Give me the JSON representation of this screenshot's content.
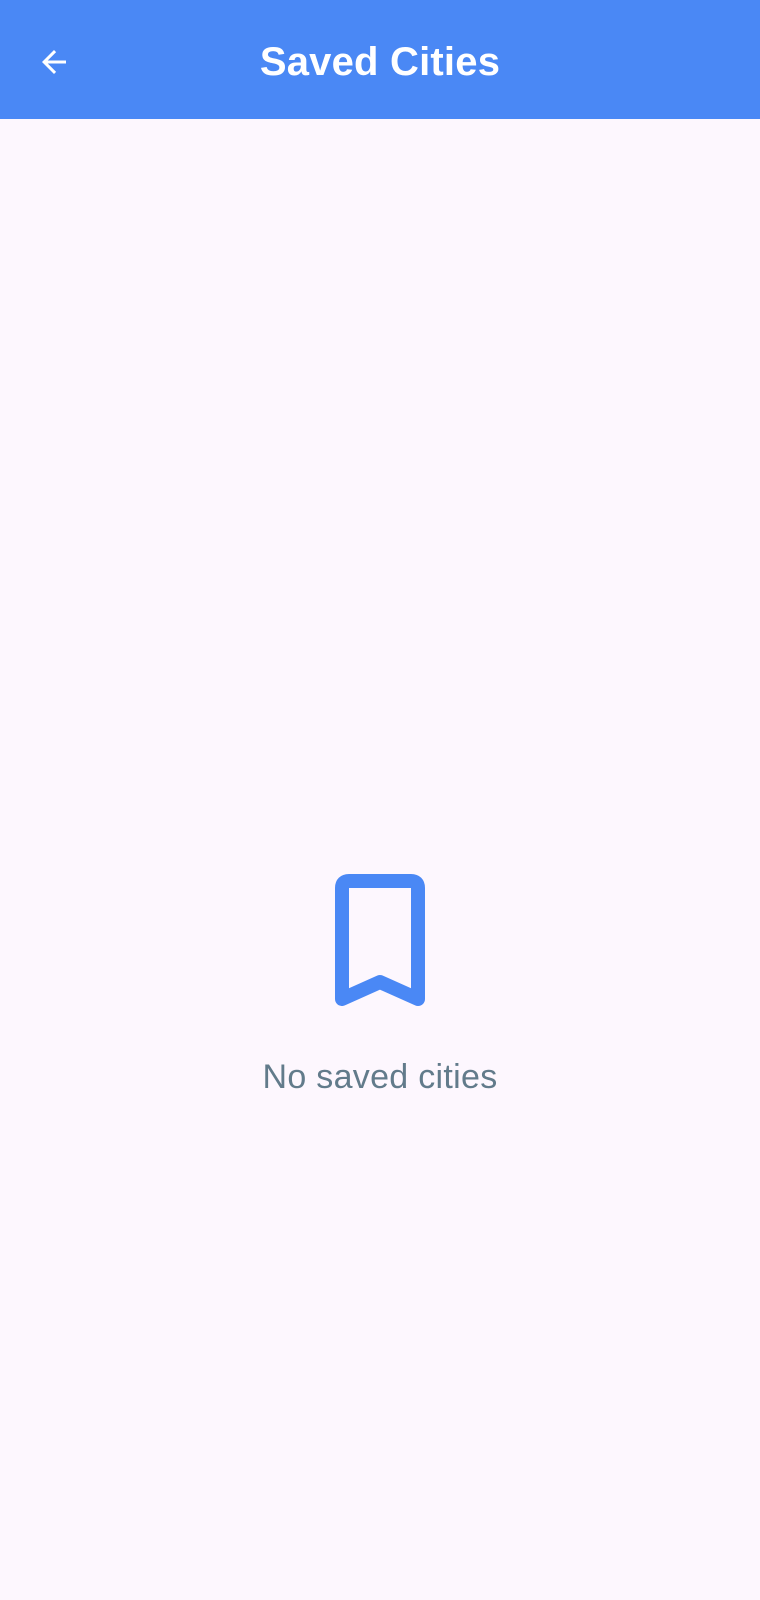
{
  "header": {
    "title": "Saved Cities",
    "back_icon": "arrow-back-icon"
  },
  "empty_state": {
    "icon": "bookmark-outline-icon",
    "message": "No saved cities"
  },
  "colors": {
    "app_bar": "#4a88f5",
    "accent": "#4a88f5",
    "background": "#fdf7fe",
    "muted_text": "#627b8b"
  }
}
